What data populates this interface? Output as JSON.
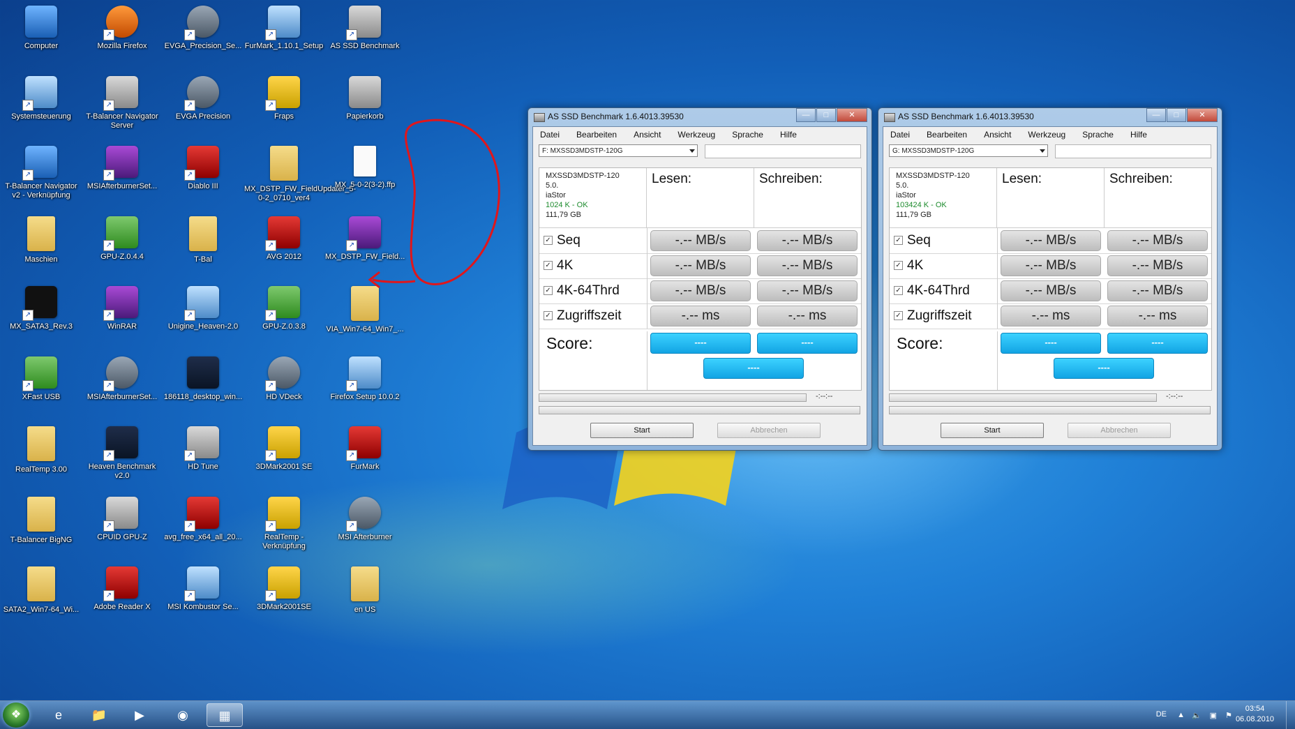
{
  "desktop": {
    "icons": [
      {
        "label": "Computer",
        "icon": "computer-icon"
      },
      {
        "label": "Mozilla Firefox",
        "icon": "firefox-icon"
      },
      {
        "label": "EVGA_Precision_Se...",
        "icon": "evga-icon"
      },
      {
        "label": "FurMark_1.10.1_Setup",
        "icon": "installer-icon"
      },
      {
        "label": "AS SSD Benchmark",
        "icon": "as-ssd-icon"
      },
      {
        "label": "Systemsteuerung",
        "icon": "control-panel-icon"
      },
      {
        "label": "T-Balancer Navigator Server",
        "icon": "tbalancer-server-icon"
      },
      {
        "label": "EVGA Precision",
        "icon": "evga-icon"
      },
      {
        "label": "Fraps",
        "icon": "fraps-icon"
      },
      {
        "label": "Papierkorb",
        "icon": "recycle-bin-icon"
      },
      {
        "label": "T-Balancer Navigator v2 - Verknüpfung",
        "icon": "tbalancer-icon"
      },
      {
        "label": "MSIAfterburnerSet...",
        "icon": "winrar-icon"
      },
      {
        "label": "Diablo III",
        "icon": "diablo-icon"
      },
      {
        "label": "MX_DSTP_FW_FieldUpdater_5-0-2_0710_ver4",
        "icon": "folder-icon"
      },
      {
        "label": "MX_5-0-2(3-2).ffp",
        "icon": "file-icon"
      },
      {
        "label": "Maschien",
        "icon": "folder-icon"
      },
      {
        "label": "GPU-Z.0.4.4",
        "icon": "gpuz-icon"
      },
      {
        "label": "T-Bal",
        "icon": "folder-icon"
      },
      {
        "label": "AVG 2012",
        "icon": "avg-icon"
      },
      {
        "label": "MX_DSTP_FW_Field...",
        "icon": "winrar-icon"
      },
      {
        "label": "MX_SATA3_Rev.3",
        "icon": "firmware-icon"
      },
      {
        "label": "WinRAR",
        "icon": "winrar-icon"
      },
      {
        "label": "Unigine_Heaven-2.0",
        "icon": "installer-icon"
      },
      {
        "label": "GPU-Z.0.3.8",
        "icon": "gpuz-icon"
      },
      {
        "label": "VIA_Win7-64_Win7_...",
        "icon": "folder-icon"
      },
      {
        "label": "XFast USB",
        "icon": "xfast-icon"
      },
      {
        "label": "MSIAfterburnerSet...",
        "icon": "afterburner-icon"
      },
      {
        "label": "186118_desktop_win...",
        "icon": "image-icon"
      },
      {
        "label": "HD VDeck",
        "icon": "hdvdeck-icon"
      },
      {
        "label": "Firefox Setup 10.0.2",
        "icon": "installer-icon"
      },
      {
        "label": "RealTemp 3.00",
        "icon": "folder-icon"
      },
      {
        "label": "Heaven Benchmark v2.0",
        "icon": "heaven-icon"
      },
      {
        "label": "HD Tune",
        "icon": "hdtune-icon"
      },
      {
        "label": "3DMark2001 SE",
        "icon": "3dmark-icon"
      },
      {
        "label": "FurMark",
        "icon": "furmark-icon"
      },
      {
        "label": "T-Balancer BigNG",
        "icon": "folder-icon"
      },
      {
        "label": "CPUID GPU-Z",
        "icon": "cpuid-icon"
      },
      {
        "label": "avg_free_x64_all_20...",
        "icon": "avg-icon"
      },
      {
        "label": "RealTemp - Verknüpfung",
        "icon": "realtemp-icon"
      },
      {
        "label": "MSI Afterburner",
        "icon": "afterburner-icon"
      },
      {
        "label": "SATA2_Win7-64_Wi...",
        "icon": "folder-icon"
      },
      {
        "label": "Adobe Reader X",
        "icon": "adobe-reader-icon"
      },
      {
        "label": "MSI Kombustor Se...",
        "icon": "installer-icon"
      },
      {
        "label": "3DMark2001SE",
        "icon": "3dmark-icon"
      },
      {
        "label": "en US",
        "icon": "folder-icon"
      }
    ]
  },
  "windows": [
    {
      "title": "AS SSD Benchmark 1.6.4013.39530",
      "menu": [
        "Datei",
        "Bearbeiten",
        "Ansicht",
        "Werkzeug",
        "Sprache",
        "Hilfe"
      ],
      "drive": "F: MXSSD3MDSTP-120G",
      "info": {
        "model": "MXSSD3MDSTP-120",
        "fw": "5.0.",
        "driver": "iaStor",
        "align": "1024 K - OK",
        "size": "111,79 GB"
      },
      "col_read": "Lesen:",
      "col_write": "Schreiben:",
      "rows": [
        {
          "name": "Seq",
          "read": "-.-- MB/s",
          "write": "-.-- MB/s"
        },
        {
          "name": "4K",
          "read": "-.-- MB/s",
          "write": "-.-- MB/s"
        },
        {
          "name": "4K-64Thrd",
          "read": "-.-- MB/s",
          "write": "-.-- MB/s"
        },
        {
          "name": "Zugriffszeit",
          "read": "-.-- ms",
          "write": "-.-- ms"
        }
      ],
      "score_label": "Score:",
      "score_read": "----",
      "score_write": "----",
      "score_total": "----",
      "time": "-:--:--",
      "start": "Start",
      "abort": "Abbrechen"
    },
    {
      "title": "AS SSD Benchmark 1.6.4013.39530",
      "menu": [
        "Datei",
        "Bearbeiten",
        "Ansicht",
        "Werkzeug",
        "Sprache",
        "Hilfe"
      ],
      "drive": "G: MXSSD3MDSTP-120G",
      "info": {
        "model": "MXSSD3MDSTP-120",
        "fw": "5.0.",
        "driver": "iaStor",
        "align": "103424 K - OK",
        "size": "111,79 GB"
      },
      "col_read": "Lesen:",
      "col_write": "Schreiben:",
      "rows": [
        {
          "name": "Seq",
          "read": "-.-- MB/s",
          "write": "-.-- MB/s"
        },
        {
          "name": "4K",
          "read": "-.-- MB/s",
          "write": "-.-- MB/s"
        },
        {
          "name": "4K-64Thrd",
          "read": "-.-- MB/s",
          "write": "-.-- MB/s"
        },
        {
          "name": "Zugriffszeit",
          "read": "-.-- ms",
          "write": "-.-- ms"
        }
      ],
      "score_label": "Score:",
      "score_read": "----",
      "score_write": "----",
      "score_total": "----",
      "time": "-:--:--",
      "start": "Start",
      "abort": "Abbrechen"
    }
  ],
  "taskbar": {
    "items": [
      "internet-explorer-icon",
      "explorer-icon",
      "media-player-icon",
      "firefox-icon",
      "as-ssd-icon"
    ],
    "lang": "DE",
    "time": "03:54",
    "date": "06.08.2010"
  },
  "colors": {
    "annotation": "#e0161b",
    "score": "#1fb8f0",
    "ok": "#1d8b2d"
  }
}
